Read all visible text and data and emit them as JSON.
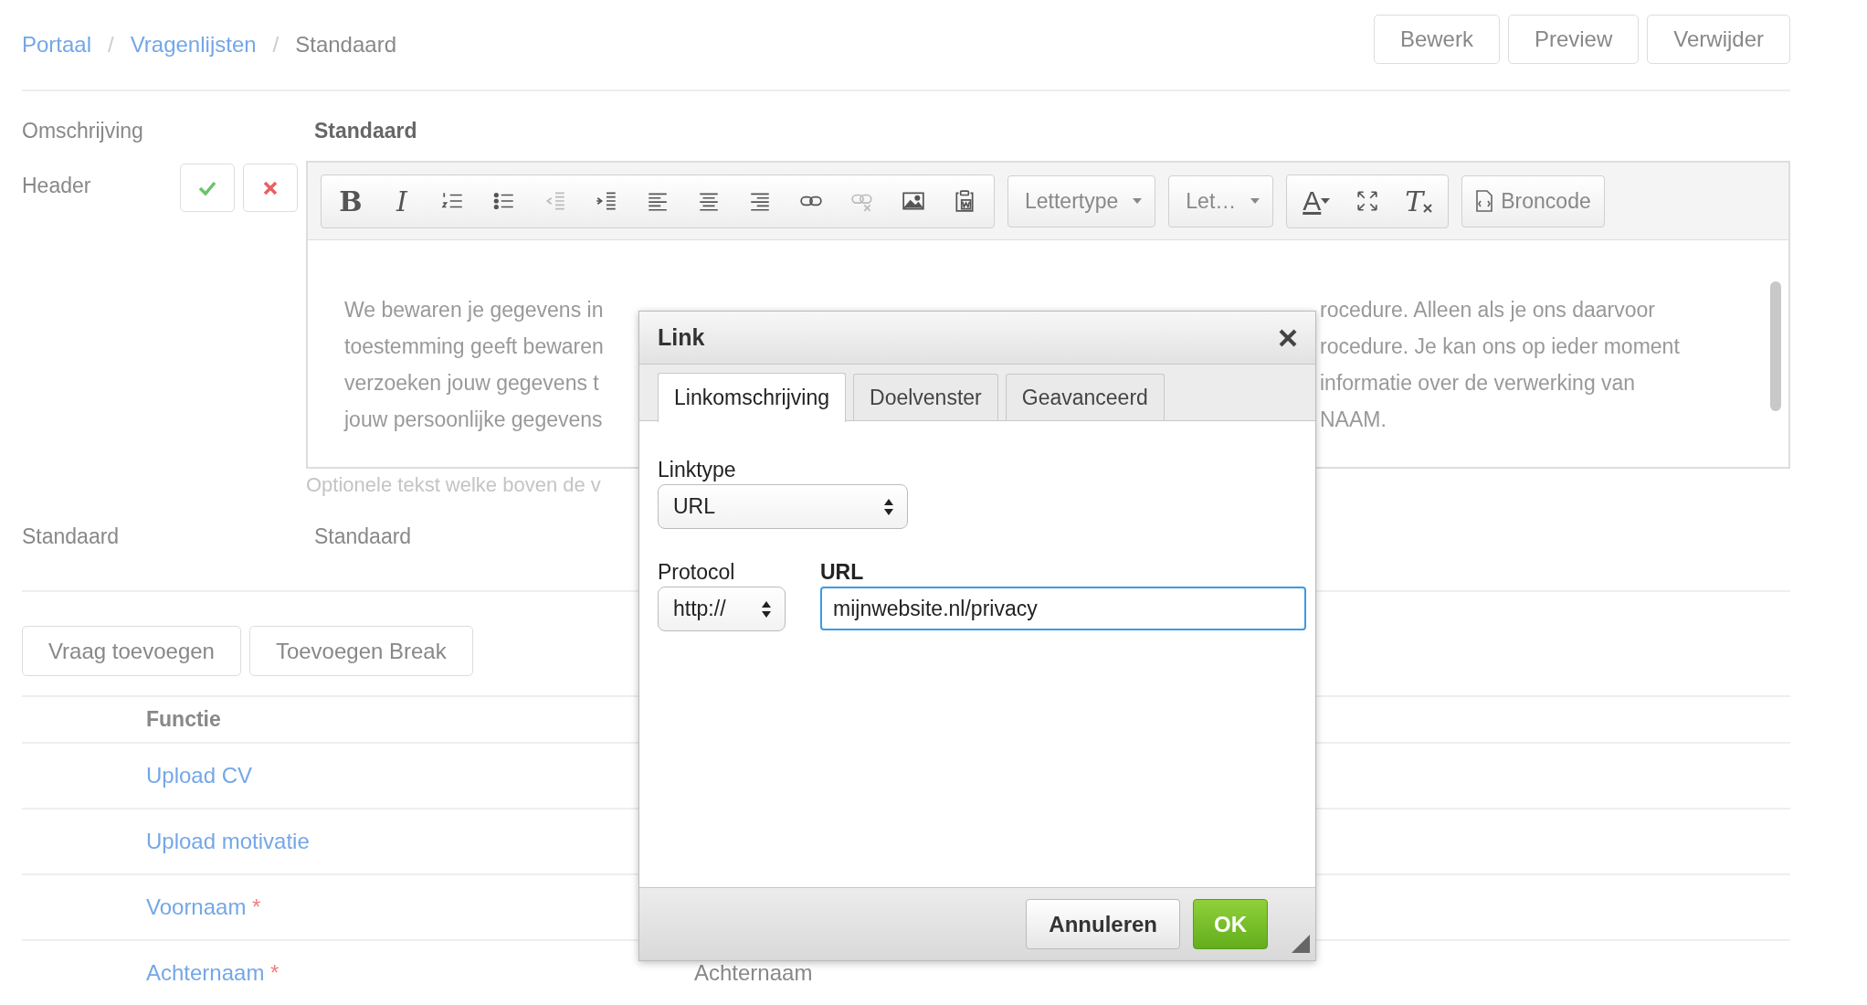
{
  "breadcrumb": [
    {
      "label": "Portaal",
      "kind": "link"
    },
    {
      "label": "Vragenlijsten",
      "kind": "link"
    },
    {
      "label": "Standaard",
      "kind": "current"
    }
  ],
  "breadcrumb_separator": "/",
  "header_buttons": [
    "Bewerk",
    "Preview",
    "Verwijder"
  ],
  "omschrijving": {
    "label": "Omschrijving",
    "value": "Standaard"
  },
  "header_field": {
    "label": "Header",
    "hint": "Optionele tekst welke boven de v"
  },
  "toolbar": [
    {
      "kind": "bold",
      "glyph": "B",
      "disabled": false
    },
    {
      "kind": "italic",
      "glyph": "I",
      "disabled": false
    },
    {
      "kind": "numbered-list",
      "disabled": false
    },
    {
      "kind": "bullet-list",
      "disabled": false
    },
    {
      "kind": "outdent",
      "disabled": true
    },
    {
      "kind": "indent",
      "disabled": false
    },
    {
      "kind": "align-left",
      "disabled": false
    },
    {
      "kind": "align-center",
      "disabled": false
    },
    {
      "kind": "align-right",
      "disabled": false
    },
    {
      "kind": "link",
      "disabled": false
    },
    {
      "kind": "unlink",
      "disabled": true
    },
    {
      "kind": "image",
      "disabled": false
    },
    {
      "kind": "paste-word",
      "disabled": false
    }
  ],
  "font_dropdowns": [
    "Lettertype",
    "Let…"
  ],
  "toolbar_extra": [
    {
      "kind": "text-color",
      "glyph": "A"
    },
    {
      "kind": "maximize"
    },
    {
      "kind": "remove-format",
      "glyph": "T"
    }
  ],
  "source_button": "Broncode",
  "editor_lines": [
    {
      "left": "We bewaren je gegevens in",
      "right": "rocedure. Alleen als je ons daarvoor"
    },
    {
      "left": "toestemming geeft bewaren",
      "right": "rocedure. Je kan ons op ieder moment"
    },
    {
      "left": "verzoeken jouw gegevens t",
      "right": "informatie over de verwerking van"
    },
    {
      "left": "jouw persoonlijke gegevens",
      "right": "NAAM."
    }
  ],
  "standaard": {
    "label": "Standaard",
    "value": "Standaard"
  },
  "action_buttons": [
    "Vraag toevoegen",
    "Toevoegen Break"
  ],
  "table": {
    "columns": [
      "Functie"
    ],
    "rows": [
      {
        "name": "Upload CV",
        "required": false
      },
      {
        "name": "Upload motivatie",
        "required": false
      },
      {
        "name": "Voornaam",
        "required": true
      },
      {
        "name": "Achternaam",
        "required": true,
        "column_2": "Achternaam"
      }
    ]
  },
  "required_mark": "*",
  "dialog": {
    "title": "Link",
    "tabs": [
      {
        "label": "Linkomschrijving",
        "selected": true
      },
      {
        "label": "Doelvenster",
        "selected": false
      },
      {
        "label": "Geavanceerd",
        "selected": false
      }
    ],
    "linktype": {
      "label": "Linktype",
      "value": "URL"
    },
    "protocol": {
      "label": "Protocol",
      "value": "http://"
    },
    "url": {
      "label": "URL",
      "value": "mijnwebsite.nl/privacy"
    },
    "buttons": [
      {
        "label": "Annuleren",
        "kind": "secondary"
      },
      {
        "label": "OK",
        "kind": "primary"
      }
    ]
  }
}
